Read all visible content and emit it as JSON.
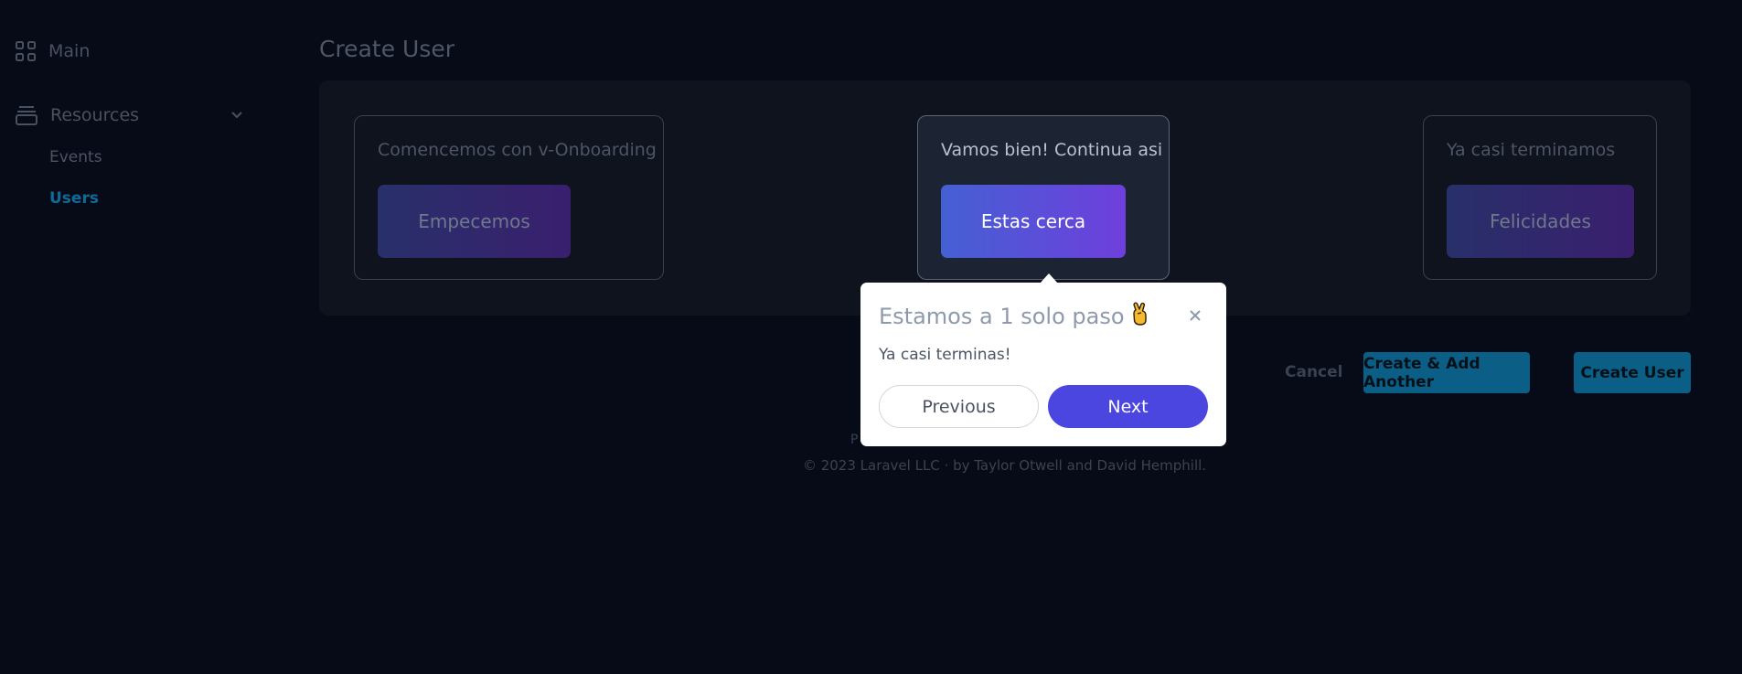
{
  "sidebar": {
    "main_label": "Main",
    "resources_label": "Resources",
    "items": [
      {
        "label": "Events"
      },
      {
        "label": "Users"
      }
    ]
  },
  "page": {
    "title": "Create User"
  },
  "steps": [
    {
      "label": "Comencemos con v-Onboarding",
      "button": "Empecemos"
    },
    {
      "label": "Vamos bien! Continua asi",
      "button": "Estas cerca"
    },
    {
      "label": "Ya casi terminamos",
      "button": "Felicidades"
    }
  ],
  "actions": {
    "cancel": "Cancel",
    "create_another": "Create & Add Another",
    "create": "Create User"
  },
  "footer": {
    "line1": "P",
    "line2": "© 2023 Laravel LLC · by Taylor Otwell and David Hemphill."
  },
  "popover": {
    "title": "Estamos a 1 solo paso",
    "emoji_icon": "crossed-fingers-icon",
    "description": "Ya casi terminas!",
    "previous": "Previous",
    "next": "Next"
  },
  "colors": {
    "background": "#070b18",
    "accent": "#0b5e86",
    "next_button": "#4b46e0",
    "active_link": "#0f6a97"
  }
}
